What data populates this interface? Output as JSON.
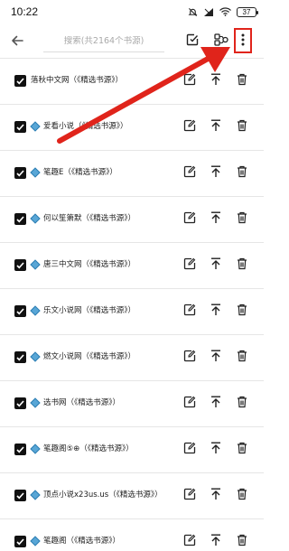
{
  "status_bar": {
    "time": "10:22",
    "battery": "37"
  },
  "toolbar": {
    "search_placeholder": "搜索(共2164个书源)",
    "icons": [
      "back-arrow-icon",
      "select-all-icon",
      "share-icon",
      "more-vertical-icon"
    ]
  },
  "sources": [
    {
      "label": "落秋中文网（《精选书源》）",
      "checked": true,
      "diamond": false
    },
    {
      "label": "爱看小说（《精选书源》）",
      "checked": true,
      "diamond": true
    },
    {
      "label": "笔趣E（《精选书源》）",
      "checked": true,
      "diamond": true
    },
    {
      "label": "何以笙箫默（《精选书源》）",
      "checked": true,
      "diamond": true
    },
    {
      "label": "唐三中文网（《精选书源》）",
      "checked": true,
      "diamond": true
    },
    {
      "label": "乐文小说网（《精选书源》）",
      "checked": true,
      "diamond": true
    },
    {
      "label": "燃文小说网（《精选书源》）",
      "checked": true,
      "diamond": true
    },
    {
      "label": "选书网（《精选书源》）",
      "checked": true,
      "diamond": true
    },
    {
      "label": "笔趣阁⑤⊕（《精选书源》）",
      "checked": true,
      "diamond": true
    },
    {
      "label": "顶点小说x23us.us（《精选书源》）",
      "checked": true,
      "diamond": true
    },
    {
      "label": "笔趣阁（《精选书源》）",
      "checked": true,
      "diamond": true
    }
  ],
  "row_actions": [
    "edit-icon",
    "move-to-top-icon",
    "delete-icon"
  ],
  "annotation": {
    "color": "#e0241b"
  }
}
